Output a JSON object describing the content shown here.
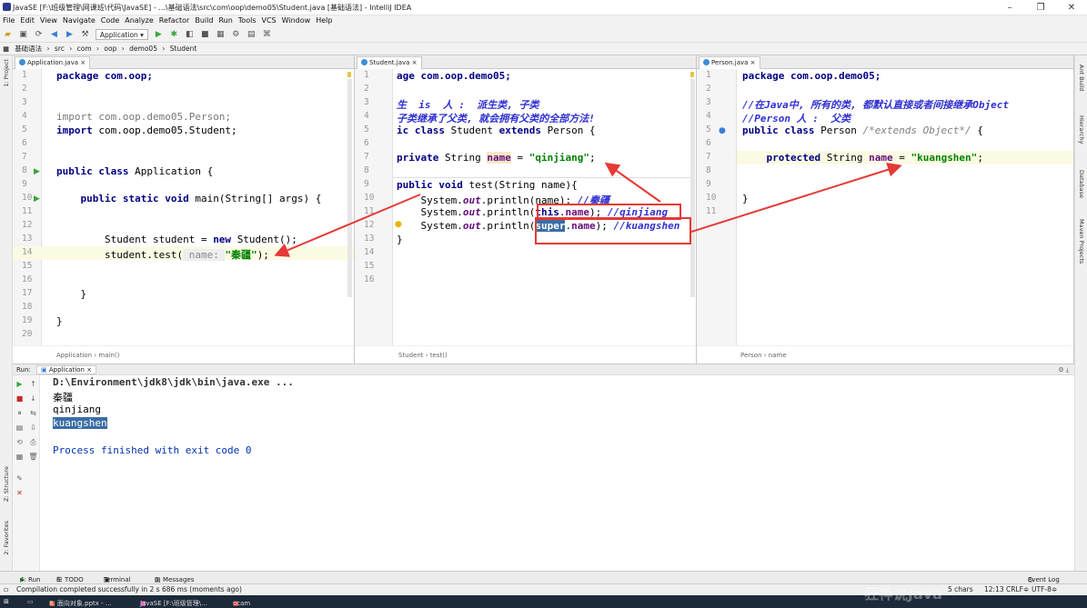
{
  "window": {
    "title": "JavaSE [F:\\班级管理\\网课班\\代码\\JavaSE] - ...\\基础语法\\src\\com\\oop\\demo05\\Student.java [基础语法] - IntelliJ IDEA",
    "minimize": "–",
    "maximize": "❐",
    "close": "✕"
  },
  "menu": [
    "File",
    "Edit",
    "View",
    "Navigate",
    "Code",
    "Analyze",
    "Refactor",
    "Build",
    "Run",
    "Tools",
    "VCS",
    "Window",
    "Help"
  ],
  "toolbar": {
    "run_config": "Application"
  },
  "breadcrumb": [
    "基础语法",
    "src",
    "com",
    "oop",
    "demo05",
    "Student"
  ],
  "left_strip": {
    "project": "1: Project",
    "structure": "Z: Structure",
    "favorites": "2: Favorites"
  },
  "right_strip": {
    "ant": "Ant Build",
    "hierarchy": "Hierarchy",
    "database": "Database",
    "maven": "Maven Projects"
  },
  "editors": {
    "application": {
      "tab": "Application.java",
      "lines": [
        "1",
        "2",
        "3",
        "4",
        "5",
        "6",
        "7",
        "8",
        "9",
        "10",
        "11",
        "12",
        "13",
        "14",
        "15",
        "16",
        "17",
        "18",
        "19",
        "20"
      ],
      "code": {
        "l1": "package com.oop;",
        "l4a": "import ",
        "l4b": "com.oop.demo05.Person;",
        "l5a": "import ",
        "l5b": "com.oop.demo05.Student;",
        "l8a": "public class ",
        "l8b": "Application {",
        "l10a": "    public static void ",
        "l10b": "main(String[] args) {",
        "l13a": "        Student student = ",
        "l13b": "new ",
        "l13c": "Student();",
        "l14a": "        student.test(",
        "l14b": " name: ",
        "l14c": "\"秦疆\"",
        "l14d": ");",
        "l17": "    }",
        "l19": "}"
      },
      "status": [
        "Application",
        "main()"
      ]
    },
    "student": {
      "tab": "Student.java",
      "lines": [
        "1",
        "2",
        "3",
        "4",
        "5",
        "6",
        "7",
        "8",
        "9",
        "10",
        "11",
        "12",
        "13",
        "14",
        "15",
        "16"
      ],
      "code": {
        "l1": "age com.oop.demo05;",
        "l3": "生  is  人 :  派生类, 子类",
        "l4": "子类继承了父类, 就会拥有父类的全部方法!",
        "l5a": "ic class ",
        "l5b": "Student ",
        "l5c": "extends ",
        "l5d": "Person {",
        "l7a": "private ",
        "l7b": "String ",
        "l7c": "name",
        "l7d": " = ",
        "l7e": "\"qinjiang\"",
        "l7f": ";",
        "l9a": "public void ",
        "l9b": "test(String name){",
        "l10a": "    System.",
        "l10b": "out",
        "l10c": ".println(name); ",
        "l10d": "//秦疆",
        "l11a": "    System.",
        "l11b": "out",
        "l11c": ".println(",
        "l11d": "this",
        "l11e": ".",
        "l11f": "name",
        "l11g": "); ",
        "l11h": "//qinjiang",
        "l12a": "    System.",
        "l12b": "out",
        "l12c": ".println(",
        "l12d": "super",
        "l12e": ".",
        "l12f": "name",
        "l12g": "); ",
        "l12h": "//kuangshen",
        "l13": "}"
      },
      "status": [
        "Student",
        "test()"
      ]
    },
    "person": {
      "tab": "Person.java",
      "lines": [
        "1",
        "2",
        "3",
        "4",
        "5",
        "6",
        "7",
        "8",
        "9",
        "10",
        "11"
      ],
      "code": {
        "l1": "package com.oop.demo05;",
        "l3": "//在Java中, 所有的类, 都默认直接或者间接继承Object",
        "l4": "//Person 人 :  父类",
        "l5a": "public class ",
        "l5b": "Person ",
        "l5c": "/*extends Object*/",
        "l5d": " {",
        "l7a": "    protected ",
        "l7b": "String ",
        "l7c": "name",
        "l7d": " = ",
        "l7e": "\"kuangshen\"",
        "l7f": ";",
        "l10": "}"
      },
      "status": [
        "Person",
        "name"
      ]
    }
  },
  "run": {
    "label": "Run:",
    "tab": "Application",
    "output": [
      "D:\\Environment\\jdk8\\jdk\\bin\\java.exe ...",
      "秦疆",
      "qinjiang",
      "kuangshen",
      "",
      "Process finished with exit code 0"
    ]
  },
  "bottom_tabs": [
    "4: Run",
    "6: TODO",
    "Terminal",
    "0: Messages",
    "Event Log"
  ],
  "statusbar": {
    "message": "Compilation completed successfully in 2 s 686 ms (moments ago)",
    "right": [
      "5 chars",
      "12:13",
      "CRLF≑",
      "UTF-8≑"
    ]
  },
  "taskbar": {
    "items": [
      "8. 面向对象.pptx - ...",
      "JavaSE [F:\\班级管理\\...",
      "ocam"
    ],
    "watermark": "狂神说Java"
  },
  "colors": {
    "keyword": "#000080",
    "string": "#008000",
    "field": "#660e7a",
    "annotation_red": "#e53935",
    "selection": "#3a6ea5"
  }
}
